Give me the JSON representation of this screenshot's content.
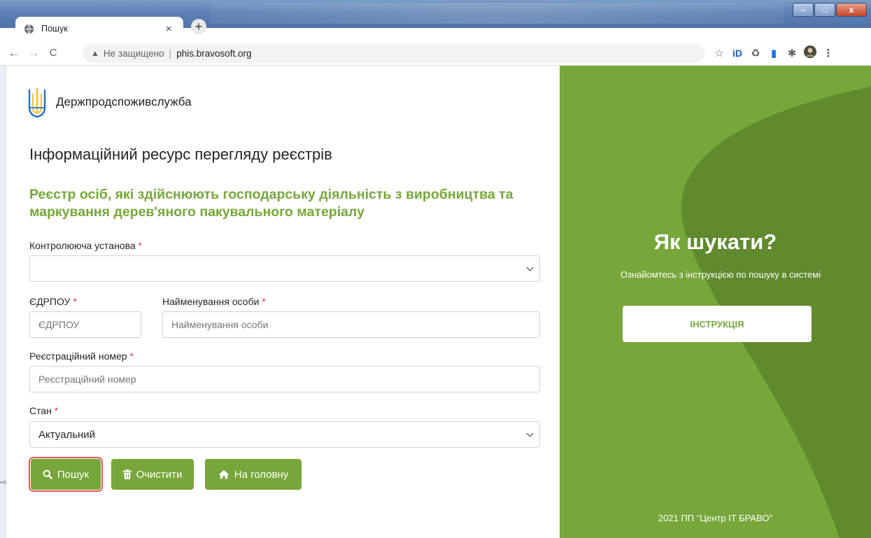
{
  "browser": {
    "tab_title": "Пошук",
    "tab_close": "×",
    "new_tab": "+",
    "window_controls": {
      "minimize": "–",
      "maximize": "□",
      "close": "x"
    },
    "nav": {
      "back": "←",
      "forward": "→",
      "reload": "C"
    },
    "address": {
      "security_icon": "▲",
      "security_text": "Не защищено",
      "separator": "|",
      "url": "phis.bravosoft.org"
    },
    "toolbar_icons": [
      "star-icon",
      "id-extension-icon",
      "recycle-extension-icon",
      "trash-extension-icon",
      "puzzle-extensions-icon",
      "profile-avatar-icon",
      "more-menu-icon"
    ]
  },
  "page": {
    "brand": "Держпродспоживслужба",
    "main_title": "Інформаційний ресурс перегляду реєстрів",
    "registry_title": "Реєстр осіб, які здійснюють господарську діяльність з виробництва та маркування дерев'яного пакувального матеріалу",
    "required_mark": "*",
    "form": {
      "authority": {
        "label": "Контролююча установа",
        "value": ""
      },
      "edrpou": {
        "label": "ЄДРПОУ",
        "placeholder": "ЄДРПОУ"
      },
      "name": {
        "label": "Найменування особи",
        "placeholder": "Найменування особи"
      },
      "reg_number": {
        "label": "Реєстраційний номер",
        "placeholder": "Реєстраційний номер"
      },
      "status": {
        "label": "Стан",
        "value": "Актуальний"
      }
    },
    "buttons": {
      "search": "Пошук",
      "clear": "Очистити",
      "home": "На головну"
    }
  },
  "side": {
    "heading": "Як шукати?",
    "subtext": "Ознайомтесь з інструкцією по пошуку в системі",
    "instruction_button": "ІНСТРУКЦІЯ",
    "footer": "2021 ПП \"Центр IT БРАВО\""
  },
  "colors": {
    "accent": "#77a63a",
    "accent_dark": "#5f8a2d",
    "required": "#dc3545",
    "highlight": "#e05757"
  }
}
